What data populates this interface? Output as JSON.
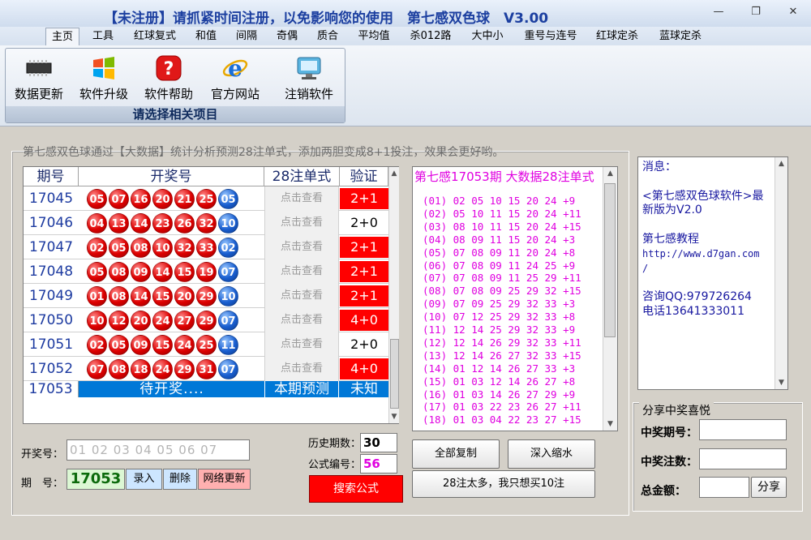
{
  "window": {
    "title": "【未注册】请抓紧时间注册，以免影响您的使用　第七感双色球　V3.00",
    "minimize_icon": "minimize-icon",
    "restore_icon": "restore-icon",
    "close_icon": "close-icon"
  },
  "tabs": [
    "主页",
    "工具",
    "红球复式",
    "和值",
    "间隔",
    "奇偶",
    "质合",
    "平均值",
    "杀012路",
    "大中小",
    "重号与连号",
    "红球定杀",
    "蓝球定杀"
  ],
  "ribbon": {
    "buttons": [
      {
        "label": "数据更新",
        "icon": "chip-icon"
      },
      {
        "label": "软件升级",
        "icon": "windows-logo-icon"
      },
      {
        "label": "软件帮助",
        "icon": "help-icon"
      },
      {
        "label": "官方网站",
        "icon": "browser-icon"
      },
      {
        "label": "注销软件",
        "icon": "monitor-icon"
      }
    ],
    "group_label": "请选择相关项目"
  },
  "caption": "第七感双色球通过【大数据】统计分析预测28注单式，添加两胆变成8+1投注，效果会更好哟。",
  "grid": {
    "headers": [
      "期号",
      "开奖号",
      "28注单式",
      "验证"
    ],
    "view_label": "点击查看",
    "rows": [
      {
        "period": "17045",
        "red": [
          "05",
          "07",
          "16",
          "20",
          "21",
          "25"
        ],
        "blue": "05",
        "verify": "2+1",
        "hit": true
      },
      {
        "period": "17046",
        "red": [
          "04",
          "13",
          "14",
          "23",
          "26",
          "32"
        ],
        "blue": "10",
        "verify": "2+0",
        "hit": false
      },
      {
        "period": "17047",
        "red": [
          "02",
          "05",
          "08",
          "10",
          "32",
          "33"
        ],
        "blue": "02",
        "verify": "2+1",
        "hit": true
      },
      {
        "period": "17048",
        "red": [
          "05",
          "08",
          "09",
          "14",
          "15",
          "19"
        ],
        "blue": "07",
        "verify": "2+1",
        "hit": true
      },
      {
        "period": "17049",
        "red": [
          "01",
          "08",
          "14",
          "15",
          "20",
          "29"
        ],
        "blue": "10",
        "verify": "2+1",
        "hit": true
      },
      {
        "period": "17050",
        "red": [
          "10",
          "12",
          "20",
          "24",
          "27",
          "29"
        ],
        "blue": "07",
        "verify": "4+0",
        "hit": true
      },
      {
        "period": "17051",
        "red": [
          "02",
          "05",
          "09",
          "15",
          "24",
          "25"
        ],
        "blue": "11",
        "verify": "2+0",
        "hit": false
      },
      {
        "period": "17052",
        "red": [
          "07",
          "08",
          "18",
          "24",
          "29",
          "31"
        ],
        "blue": "07",
        "verify": "4+0",
        "hit": true
      }
    ],
    "last_row": {
      "period": "17053",
      "waiting": "待开奖....",
      "forecast": "本期预测",
      "unknown": "未知"
    }
  },
  "bets": {
    "title": "第七感17053期 大数据28注单式",
    "lines": [
      "(01) 02 05 10 15 20 24 +9",
      "(02) 05 10 11 15 20 24 +11",
      "(03) 08 10 11 15 20 24 +15",
      "(04) 08 09 11 15 20 24 +3",
      "(05) 07 08 09 11 20 24 +8",
      "(06) 07 08 09 11 24 25 +9",
      "(07) 07 08 09 11 25 29 +11",
      "(08) 07 08 09 25 29 32 +15",
      "(09) 07 09 25 29 32 33 +3",
      "(10) 07 12 25 29 32 33 +8",
      "(11) 12 14 25 29 32 33 +9",
      "(12) 12 14 26 29 32 33 +11",
      "(13) 12 14 26 27 32 33 +15",
      "(14) 01 12 14 26 27 33 +3",
      "(15) 01 03 12 14 26 27 +8",
      "(16) 01 03 14 26 27 29 +9",
      "(17) 01 03 22 23 26 27 +11",
      "(18) 01 03 04 22 23 27 +15"
    ]
  },
  "message": {
    "lines": [
      "消息：",
      "",
      "<第七感双色球软件>最",
      "新版为V2.0",
      "",
      "第七感教程",
      "http://www.d7gan.com",
      "/",
      "",
      "咨询QQ:979726264",
      "电话13641333011"
    ]
  },
  "share": {
    "title": "分享中奖喜悦",
    "period_label": "中奖期号：",
    "count_label": "中奖注数：",
    "amount_label": "总金额：",
    "share_button": "分享"
  },
  "bottom": {
    "draw_label": "开奖号：",
    "draw_placeholder": "01 02 03 04 05 06 07",
    "period_label": "期　号：",
    "period_value": "17053",
    "enter_button": "录入",
    "delete_button": "删除",
    "update_button": "网络更新",
    "history_label": "历史期数：",
    "history_value": "30",
    "formula_label": "公式编号：",
    "formula_value": "56",
    "search_button": "搜索公式",
    "copy_button": "全部复制",
    "shrink_button": "深入缩水",
    "reduce_button": "28注太多，我只想买10注"
  },
  "colors": {
    "hit": "#ff0000",
    "link_blue": "#1c3aa0",
    "bet_magenta": "#e000e0"
  }
}
